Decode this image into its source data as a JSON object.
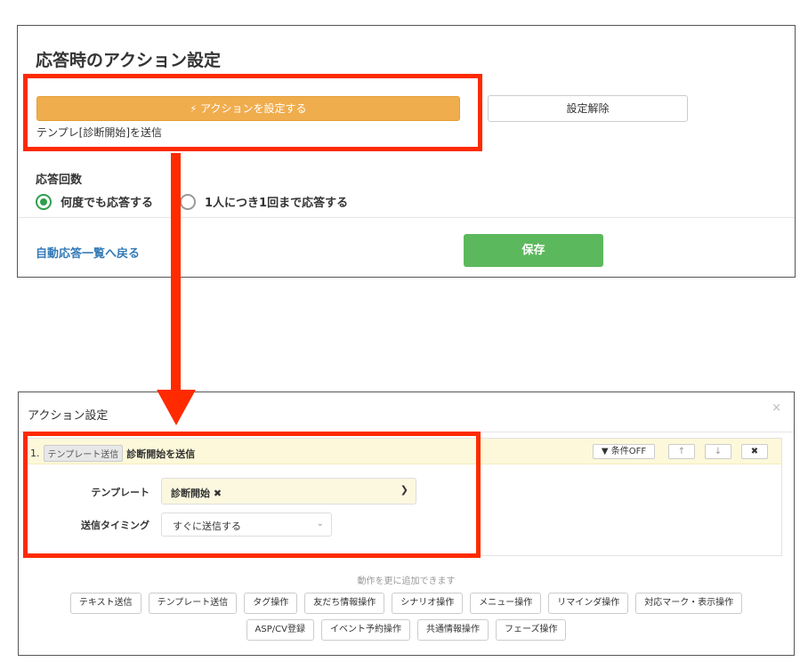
{
  "top_panel": {
    "title": "応答時のアクション設定",
    "action_button_label": "アクションを設定する",
    "action_summary": "テンプレ[診断開始]を送信",
    "clear_button_label": "設定解除",
    "response_count_label": "応答回数",
    "radio_options": [
      {
        "label": "何度でも応答する",
        "selected": true
      },
      {
        "label": "1人につき1回まで応答する",
        "selected": false
      }
    ],
    "back_link": "自動応答一覧へ戻る",
    "save_button_label": "保存"
  },
  "modal": {
    "title": "アクション設定",
    "close_glyph": "×",
    "action": {
      "index": "1.",
      "type_badge": "テンプレート送信",
      "name": "診断開始を送信",
      "cond_button": "▼ 条件OFF",
      "up_glyph": "↑",
      "down_glyph": "↓",
      "delete_glyph": "✖",
      "template_label": "テンプレート",
      "template_value": "診断開始 ✖",
      "timing_label": "送信タイミング",
      "timing_value": "すぐに送信する"
    },
    "more_text": "動作を更に追加できます",
    "buttons_row1": [
      "テキスト送信",
      "テンプレート送信",
      "タグ操作",
      "友だち情報操作",
      "シナリオ操作",
      "メニュー操作",
      "リマインダ操作",
      "対応マーク・表示操作"
    ],
    "buttons_row2": [
      "ASP/CV登録",
      "イベント予約操作",
      "共通情報操作",
      "フェーズ操作"
    ]
  },
  "colors": {
    "highlight": "#ff2a00",
    "action_button": "#f0ad4e",
    "save_button": "#5cb85c",
    "link": "#337ab7",
    "radio_selected": "#2e9e4c"
  }
}
